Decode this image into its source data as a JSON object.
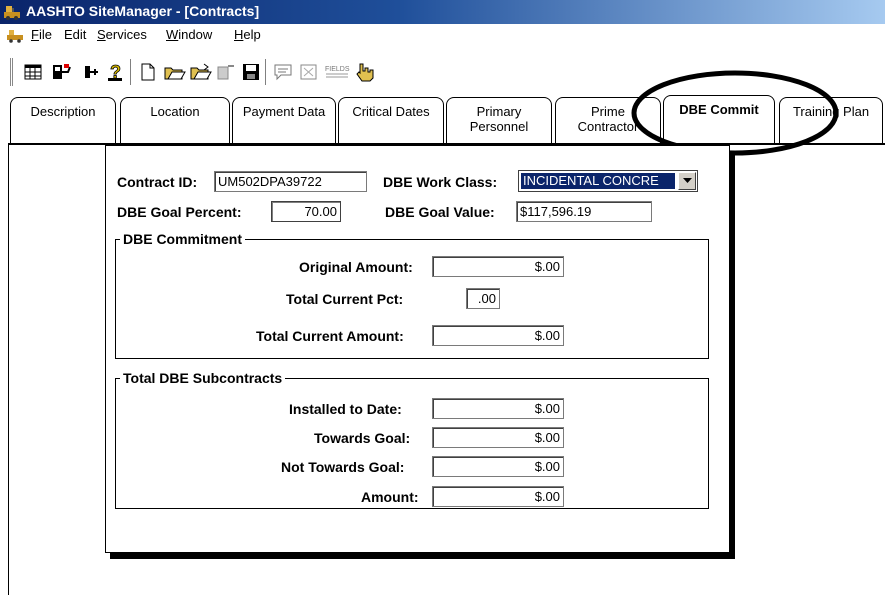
{
  "window": {
    "title": "AASHTO SiteManager - [Contracts]"
  },
  "menu": {
    "items": [
      {
        "label": "File",
        "mnemonic": "F",
        "rest": "ile"
      },
      {
        "label": "Edit",
        "mnemonic": "",
        "rest": "Edit"
      },
      {
        "label": "Services",
        "mnemonic": "S",
        "rest": "ervices"
      },
      {
        "label": "Window",
        "mnemonic": "W",
        "rest": "indow"
      },
      {
        "label": "Help",
        "mnemonic": "H",
        "rest": "elp"
      }
    ]
  },
  "toolbar": {
    "buttons": [
      "grid-icon",
      "open-window-icon",
      "pin-icon",
      "help-icon",
      "new-document-icon",
      "open-folder-icon",
      "open-folder-alt-icon",
      "delete-icon",
      "save-icon",
      "comment-icon",
      "refresh-icon",
      "fields-icon",
      "pointer-icon"
    ],
    "fields_text": "FIELDS"
  },
  "tabs": [
    {
      "label": "Description"
    },
    {
      "label": "Location"
    },
    {
      "label": "Payment Data"
    },
    {
      "label": "Critical Dates"
    },
    {
      "label": "Primary\nPersonnel"
    },
    {
      "label": "Prime\nContractor"
    },
    {
      "label": "DBE Commit",
      "active": true
    },
    {
      "label": "Training Plan"
    }
  ],
  "form": {
    "contract_id_label": "Contract ID:",
    "contract_id_value": "UM502DPA39722",
    "work_class_label": "DBE Work Class:",
    "work_class_value": "INCIDENTAL CONCRE",
    "goal_percent_label": "DBE Goal Percent:",
    "goal_percent_value": "70.00",
    "goal_value_label": "DBE Goal Value:",
    "goal_value_value": "$117,596.19",
    "commitment": {
      "title": "DBE Commitment",
      "original_amount_label": "Original Amount:",
      "original_amount_value": "$.00",
      "total_current_pct_label": "Total Current Pct:",
      "total_current_pct_value": ".00",
      "total_current_amount_label": "Total Current Amount:",
      "total_current_amount_value": "$.00"
    },
    "subcontracts": {
      "title": "Total DBE Subcontracts",
      "installed_label": "Installed to Date:",
      "installed_value": "$.00",
      "towards_label": "Towards Goal:",
      "towards_value": "$.00",
      "not_towards_label": "Not Towards Goal:",
      "not_towards_value": "$.00",
      "amount_label": "Amount:",
      "amount_value": "$.00"
    }
  },
  "colors": {
    "titlebar_start": "#0a246a",
    "titlebar_end": "#a6caf0",
    "selection": "#0a246a"
  }
}
